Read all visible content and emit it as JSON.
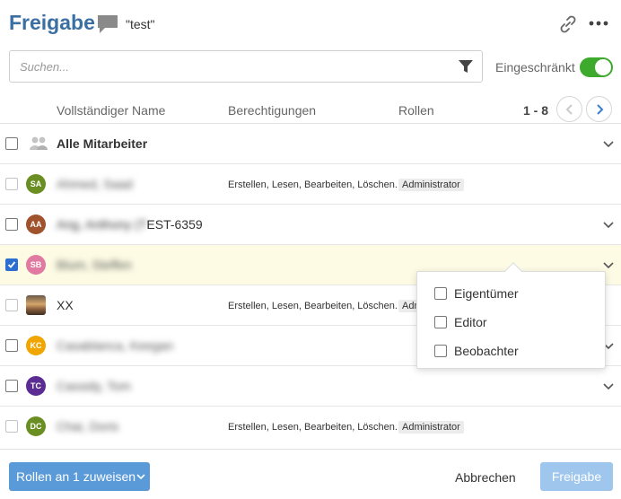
{
  "header": {
    "title": "Freigabe",
    "comment_icon": "speech-bubble-icon",
    "item_name": "\"test\"",
    "link_icon": "link-icon",
    "more_icon": "more-horizontal-icon"
  },
  "search": {
    "placeholder": "Suchen...",
    "value": "",
    "filter_icon": "filter-icon"
  },
  "restricted": {
    "label": "Eingeschränkt",
    "enabled": true,
    "color": "#3daa2e"
  },
  "columns": {
    "name": "Vollständiger Name",
    "permissions": "Berechtigungen",
    "roles": "Rollen"
  },
  "pager": {
    "range": "1 - 8"
  },
  "rows": [
    {
      "name": "Alle Mitarbeiter",
      "group": true,
      "checked": false
    },
    {
      "initials": "SA",
      "avatar_color": "#6b8e23",
      "name": "Ahmed, Saad",
      "permissions": "Erstellen, Lesen, Bearbeiten, Löschen...",
      "role": "Administrator",
      "checked": false
    },
    {
      "initials": "AA",
      "avatar_color": "#a0522d",
      "name_blurred": "Ang, Anthony (T",
      "name_visible": "EST-6359",
      "checked": false
    },
    {
      "initials": "SB",
      "avatar_color": "#e07aa0",
      "name": "Blum, Steffen",
      "checked": true
    },
    {
      "avatar_image": true,
      "name": "XX",
      "permissions": "Erstellen, Lesen, Bearbeiten, Löschen...",
      "role": "Administrator",
      "checked": false
    },
    {
      "initials": "KC",
      "avatar_color": "#f0a500",
      "name": "Casablanca, Keegan",
      "checked": false
    },
    {
      "initials": "TC",
      "avatar_color": "#5b2c91",
      "name": "Cassidy, Tom",
      "checked": false
    },
    {
      "initials": "DC",
      "avatar_color": "#6b8e23",
      "name": "Chai, Doris",
      "permissions": "Erstellen, Lesen, Bearbeiten, Löschen...",
      "role": "Administrator",
      "checked": false
    }
  ],
  "role_dropdown": {
    "options": [
      "Eigentümer",
      "Editor",
      "Beobachter"
    ]
  },
  "footer": {
    "assign_label": "Rollen an 1 zuweisen",
    "cancel_label": "Abbrechen",
    "share_label": "Freigabe"
  },
  "colors": {
    "title": "#3a6fa4",
    "primary_button": "#5a9ad8",
    "disabled_button": "#9fc6ec",
    "selected_row": "#fdfbe4",
    "checkbox_checked": "#2d6fd0"
  }
}
